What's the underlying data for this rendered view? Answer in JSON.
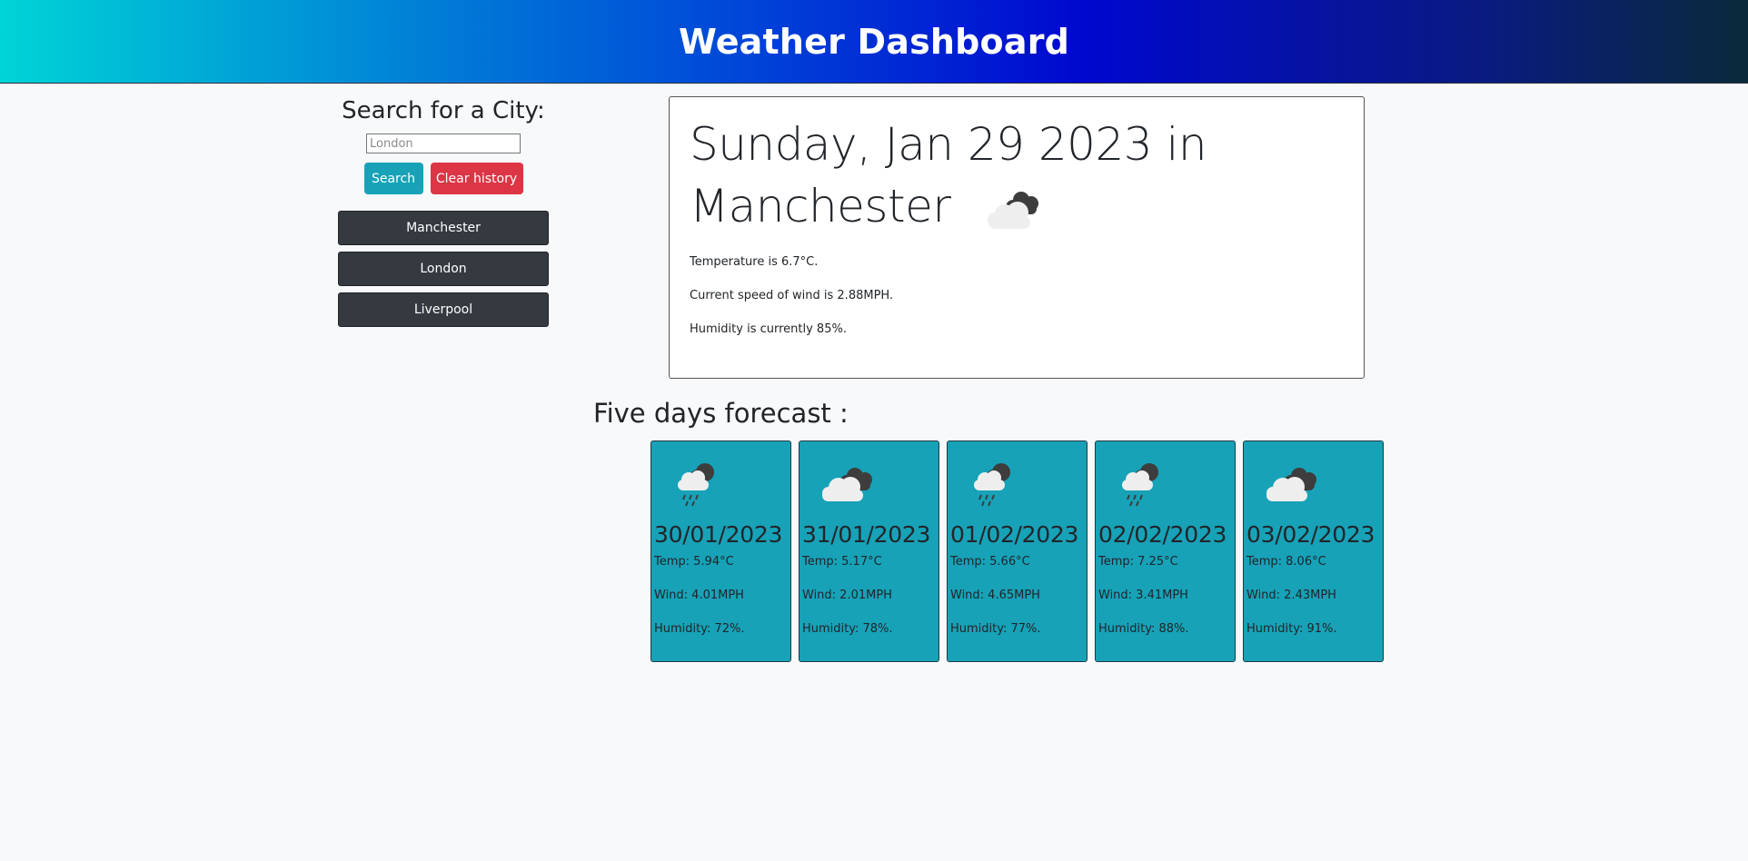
{
  "header": {
    "title": "Weather Dashboard"
  },
  "search": {
    "title": "Search for a City:",
    "placeholder": "London",
    "value": "",
    "search_label": "Search",
    "clear_label": "Clear history"
  },
  "history": [
    "Manchester",
    "London",
    "Liverpool"
  ],
  "current": {
    "title_line1": "Sunday, Jan 29 2023 in",
    "title_line2": "Manchester",
    "icon": "cloudy-icon",
    "temperature": "Temperature is 6.7°C.",
    "wind": "Current speed of wind is 2.88MPH.",
    "humidity": "Humidity is currently 85%."
  },
  "forecast": {
    "title": "Five days forecast :",
    "days": [
      {
        "icon": "rain-icon",
        "date": "30/01/2023",
        "temp": "Temp: 5.94°C",
        "wind": "Wind: 4.01MPH",
        "humidity": "Humidity: 72%."
      },
      {
        "icon": "cloudy-icon",
        "date": "31/01/2023",
        "temp": "Temp: 5.17°C",
        "wind": "Wind: 2.01MPH",
        "humidity": "Humidity: 78%."
      },
      {
        "icon": "rain-icon",
        "date": "01/02/2023",
        "temp": "Temp: 5.66°C",
        "wind": "Wind: 4.65MPH",
        "humidity": "Humidity: 77%."
      },
      {
        "icon": "rain-icon",
        "date": "02/02/2023",
        "temp": "Temp: 7.25°C",
        "wind": "Wind: 3.41MPH",
        "humidity": "Humidity: 88%."
      },
      {
        "icon": "cloudy-icon",
        "date": "03/02/2023",
        "temp": "Temp: 8.06°C",
        "wind": "Wind: 2.43MPH",
        "humidity": "Humidity: 91%."
      }
    ]
  },
  "colors": {
    "search_button": "#17a2b8",
    "clear_button": "#dc3545",
    "history_button": "#343a40",
    "forecast_card": "#17a2b8"
  }
}
